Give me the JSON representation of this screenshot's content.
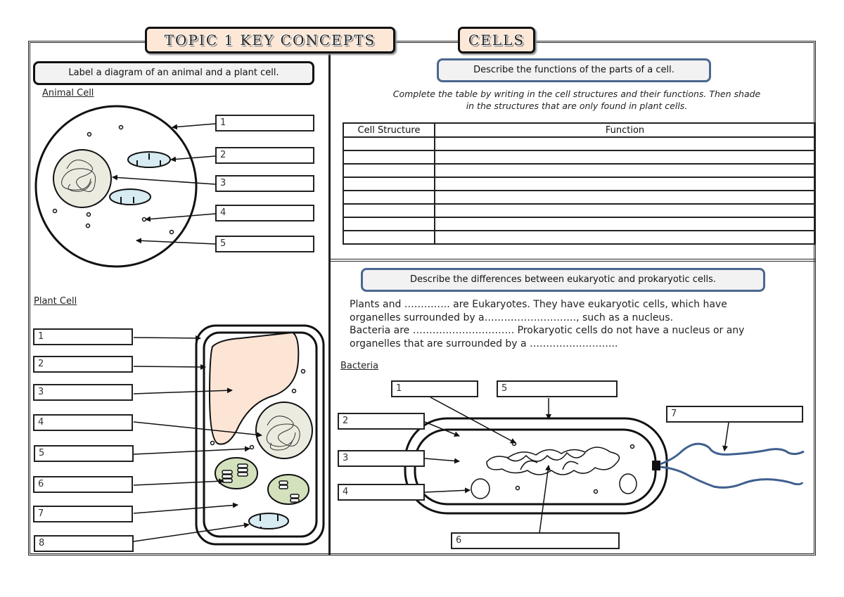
{
  "header": {
    "topic_title": "TOPIC 1 KEY CONCEPTS",
    "section_title": "CELLS"
  },
  "left_panel": {
    "task": "Label a diagram of an animal and a plant cell.",
    "animal_cell": {
      "heading": "Animal Cell ",
      "labels": [
        "1",
        "2",
        "3",
        "4",
        "5"
      ]
    },
    "plant_cell": {
      "heading": "Plant Cell",
      "labels": [
        "1",
        "2",
        "3",
        "4",
        "5",
        "6",
        "7",
        "8"
      ]
    }
  },
  "functions_panel": {
    "task": "Describe the functions of the parts of a cell.",
    "instruction_line1": "Complete the table by writing in the cell structures and their functions. Then shade",
    "instruction_line2": "in the structures that are only found in plant cells.",
    "table": {
      "headers": [
        "Cell Structure",
        "Function"
      ],
      "rows": [
        [
          "",
          ""
        ],
        [
          "",
          ""
        ],
        [
          "",
          ""
        ],
        [
          "",
          ""
        ],
        [
          "",
          ""
        ],
        [
          "",
          ""
        ],
        [
          "",
          ""
        ],
        [
          "",
          ""
        ]
      ]
    }
  },
  "differences_panel": {
    "task": "Describe the differences between eukaryotic and prokaryotic cells.",
    "paragraph_lines": [
      "Plants and ………….. are Eukaryotes. They have eukaryotic cells, which have",
      "organelles surrounded by a………………………., such as a nucleus.",
      "Bacteria are …………………………. Prokaryotic cells do not have a nucleus or any",
      "organelles that are surrounded by a ……………………..."
    ],
    "bacteria": {
      "heading": "Bacteria",
      "labels": [
        "1",
        "2",
        "3",
        "4",
        "5",
        "6",
        "7"
      ]
    }
  },
  "colors": {
    "title_tab_fill": "#fde8d8",
    "blue_box_border": "#4a6790",
    "vacuole_fill": "#fde5d6",
    "nucleus_fill": "#ecebe0",
    "chloroplast_fill": "#d3e1bd",
    "mitochondrion_fill": "#d6ebf2",
    "flagellum": "#3f5f8f"
  }
}
